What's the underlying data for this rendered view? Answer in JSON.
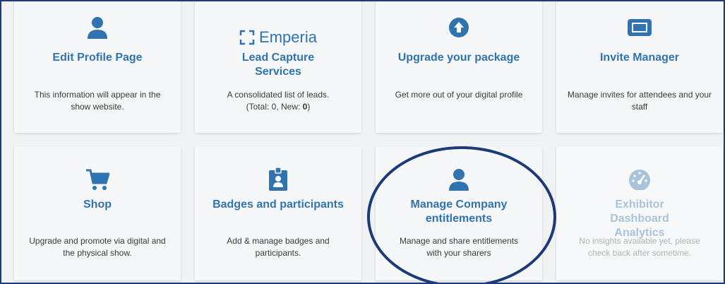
{
  "cards": [
    {
      "title": "Edit Profile Page",
      "desc": "This information will appear in the show website.",
      "icon": "user-icon"
    },
    {
      "logo": "Emperia",
      "title": "Lead Capture Services",
      "desc_prefix": "A consolidated list of leads. (Total: 0, New: ",
      "desc_new": "0",
      "desc_suffix": ")",
      "icon": "emperia-logo"
    },
    {
      "title": "Upgrade your package",
      "desc": "Get more out of your digital profile",
      "icon": "upgrade-arrow-icon"
    },
    {
      "title": "Invite Manager",
      "desc": "Manage invites for attendees and your staff",
      "icon": "ticket-icon"
    },
    {
      "title": "Shop",
      "desc": "Upgrade and promote via digital and the physical show.",
      "icon": "shopping-cart-icon"
    },
    {
      "title": "Badges and participants",
      "desc": "Add & manage badges and participants.",
      "icon": "badge-icon"
    },
    {
      "title": "Manage Company entitlements",
      "desc": "Manage and share entitlements with your sharers",
      "icon": "user-icon"
    },
    {
      "title": "Exhibitor Dashboard Analytics",
      "desc": "No insights available yet, please check back after sometime.",
      "icon": "dashboard-gauge-icon",
      "disabled": true
    }
  ],
  "colors": {
    "accent": "#2f74b0",
    "disabled_title": "#a9c3da",
    "highlight_ring": "#1c3a78"
  }
}
